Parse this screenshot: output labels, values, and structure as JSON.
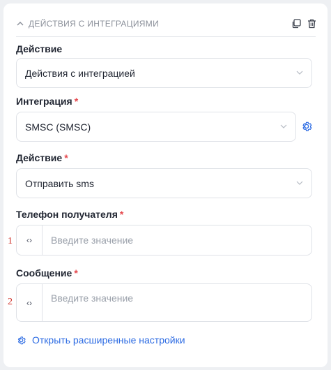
{
  "header": {
    "title": "ДЕЙСТВИЯ С ИНТЕГРАЦИЯМИ",
    "icons": [
      "chevron-up-icon",
      "copy-icon",
      "trash-icon"
    ]
  },
  "fields": {
    "action_type": {
      "label": "Действие",
      "value": "Действия с интеграцией",
      "required": false
    },
    "integration": {
      "label": "Интеграция",
      "value": "SMSC (SMSC)",
      "required": true
    },
    "action": {
      "label": "Действие",
      "value": "Отправить sms",
      "required": true
    },
    "phone": {
      "label": "Телефон получателя",
      "placeholder": "Введите значение",
      "required": true,
      "marker": "1"
    },
    "message": {
      "label": "Сообщение",
      "placeholder": "Введите значение",
      "required": true,
      "marker": "2"
    }
  },
  "required_mark": "*",
  "code_toggle": "‹›",
  "advanced_link": "Открыть расширенные настройки",
  "colors": {
    "accent": "#2c6be3",
    "required": "#e5484d",
    "border": "#dfe2e7"
  }
}
